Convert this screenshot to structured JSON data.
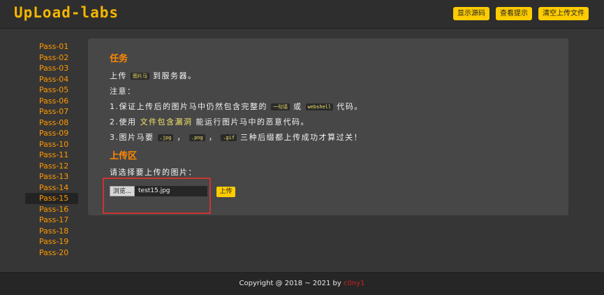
{
  "header": {
    "logo": "UpLoad-labs",
    "buttons": [
      "显示源码",
      "查看提示",
      "清空上传文件"
    ]
  },
  "sidebar": {
    "items": [
      "Pass-01",
      "Pass-02",
      "Pass-03",
      "Pass-04",
      "Pass-05",
      "Pass-06",
      "Pass-07",
      "Pass-08",
      "Pass-09",
      "Pass-10",
      "Pass-11",
      "Pass-12",
      "Pass-13",
      "Pass-14",
      "Pass-15",
      "Pass-16",
      "Pass-17",
      "Pass-18",
      "Pass-19",
      "Pass-20"
    ],
    "active": "Pass-15"
  },
  "task": {
    "title": "任务",
    "line1_pre": "上传",
    "line1_code": "图片马",
    "line1_post": "到服务器。",
    "note": "注意：",
    "line3_pre": "1.保证上传后的图片马中仍然包含完整的",
    "line3_code1": "一句话",
    "line3_mid": "或",
    "line3_code2": "webshell",
    "line3_post": "代码。",
    "line4_pre": "2.使用",
    "line4_hl": "文件包含漏洞",
    "line4_post": "能运行图片马中的恶意代码。",
    "line5_pre": "3.图片马要",
    "line5_code1": ".jpg",
    "line5_sep1": "，",
    "line5_code2": ".png",
    "line5_sep2": "，",
    "line5_code3": ".gif",
    "line5_post": "三种后缀都上传成功才算过关！"
  },
  "upload": {
    "title": "上传区",
    "prompt": "请选择要上传的图片：",
    "browse_label": "浏览...",
    "file_name": "test15.jpg",
    "submit_label": "上传"
  },
  "footer": {
    "copyright": "Copyright @ 2018 ~ 2021 by",
    "author": "c0ny1"
  },
  "colors": {
    "accent": "#ffcc00",
    "link": "#ff9900",
    "title": "#ff8800",
    "highlight_box": "#cc3333"
  }
}
